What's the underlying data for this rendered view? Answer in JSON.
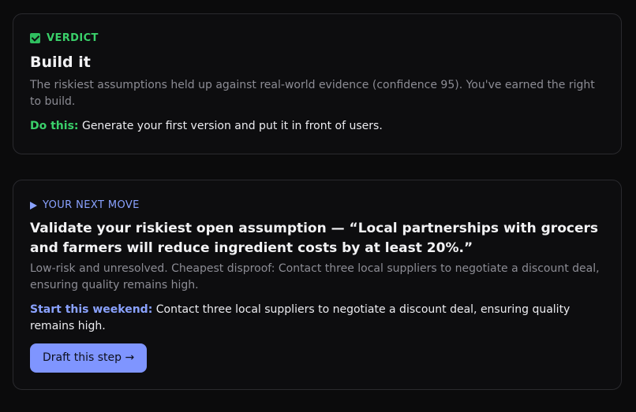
{
  "verdict": {
    "eyebrow": "VERDICT",
    "title": "Build it",
    "body": "The riskiest assumptions held up against real-world evidence (confidence 95). You've earned the right to build.",
    "action_lead": "Do this:",
    "action_text": " Generate your first version and put it in front of users."
  },
  "next_move": {
    "eyebrow": "YOUR NEXT MOVE",
    "title": "Validate your riskiest open assumption — “Local partnerships with grocers and farmers will reduce ingredient costs by at least 20%.”",
    "body": "Low-risk and unresolved. Cheapest disproof: Contact three local suppliers to negotiate a discount deal, ensuring quality remains high.",
    "action_lead": "Start this weekend:",
    "action_text": " Contact three local suppliers to negotiate a discount deal, ensuring quality remains high.",
    "button_label": "Draft this step →"
  },
  "colors": {
    "background": "#0b0b0c",
    "verdict_accent": "#3ad06a",
    "next_accent": "#8aa2ff",
    "button": "#7f95ff"
  },
  "icons": {
    "verdict": "check-box-icon",
    "next_move": "play-icon"
  }
}
